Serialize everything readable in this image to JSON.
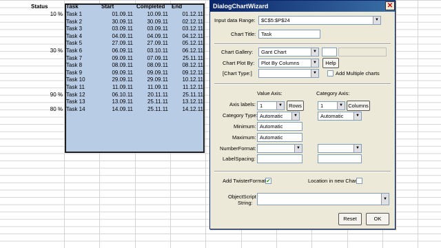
{
  "sheet": {
    "headers": {
      "status": "Status",
      "task": "Task",
      "start": "Start",
      "completed": "Completed",
      "end": "End"
    },
    "rows": [
      {
        "status": "10 %",
        "task": "Task 1",
        "start": "01.09.11",
        "completed": "10.09.11",
        "end": "01.12.11"
      },
      {
        "status": "",
        "task": "Task 2",
        "start": "30.09.11",
        "completed": "30.09.11",
        "end": "02.12.11"
      },
      {
        "status": "",
        "task": "Task 3",
        "start": "03.09.11",
        "completed": "03.09.11",
        "end": "03.12.11"
      },
      {
        "status": "",
        "task": "Task 4",
        "start": "04.09.11",
        "completed": "04.09.11",
        "end": "04.12.11"
      },
      {
        "status": "",
        "task": "Task 5",
        "start": "27.09.11",
        "completed": "27.09.11",
        "end": "05.12.11"
      },
      {
        "status": "30 %",
        "task": "Task 6",
        "start": "06.09.11",
        "completed": "03.10.11",
        "end": "06.12.11"
      },
      {
        "status": "",
        "task": "Task 7",
        "start": "09.09.11",
        "completed": "07.09.11",
        "end": "25.11.11"
      },
      {
        "status": "",
        "task": "Task 8",
        "start": "08.09.11",
        "completed": "08.09.11",
        "end": "08.12.11"
      },
      {
        "status": "",
        "task": "Task 9",
        "start": "09.09.11",
        "completed": "09.09.11",
        "end": "09.12.11"
      },
      {
        "status": "",
        "task": "Task 10",
        "start": "29.09.11",
        "completed": "29.09.11",
        "end": "10.12.11"
      },
      {
        "status": "",
        "task": "Task 11",
        "start": "11.09.11",
        "completed": "11.09.11",
        "end": "11.12.11"
      },
      {
        "status": "90 %",
        "task": "Task 12",
        "start": "06.10.11",
        "completed": "20.11.11",
        "end": "25.11.11"
      },
      {
        "status": "",
        "task": "Task 13",
        "start": "13.09.11",
        "completed": "25.11.11",
        "end": "13.12.11"
      },
      {
        "status": "80 %",
        "task": "Task 14",
        "start": "14.09.11",
        "completed": "25.11.11",
        "end": "14.12.11"
      }
    ]
  },
  "dialog": {
    "title": "DialogChartWizard",
    "close_label": "✕",
    "input_range_label": "Input data Range:",
    "input_range_value": "$C$5:$P$24",
    "chart_title_label": "Chart Title:",
    "chart_title_value": "Task",
    "gallery_label": "Chart Gallery:",
    "gallery_value": "Gant Chart",
    "plotby_label": "Chart Plot By:",
    "plotby_value": "Plot By Columns",
    "help_label": "Help",
    "charttype_label": "[Chart Type:]",
    "charttype_value": "",
    "add_multiple_label": "Add Multiple charts",
    "value_axis_label": "Value Axis:",
    "category_axis_label": "Category Axis:",
    "axis_labels_label": "Axis labels:",
    "value_axis_num": "1",
    "rows_label": "Rows",
    "category_axis_num": "1",
    "columns_label": "Columns",
    "category_type_label": "Category Type:",
    "category_type_value": "Automatic",
    "category_type_value2": "Automatic",
    "minimum_label": "Minimum:",
    "minimum_value": "Automatic",
    "maximum_label": "Maximum:",
    "maximum_value": "Automatic",
    "numberformat_label": "NumberFormat:",
    "labelspacing_label": "LabelSpacing:",
    "twister_label": "Add TwisterFormat",
    "twister_checked": "✔",
    "location_label": "Location in new Chart",
    "objectscript_label1": "ObjectScript",
    "objectscript_label2": "String:",
    "reset_label": "Reset",
    "ok_label": "OK"
  }
}
